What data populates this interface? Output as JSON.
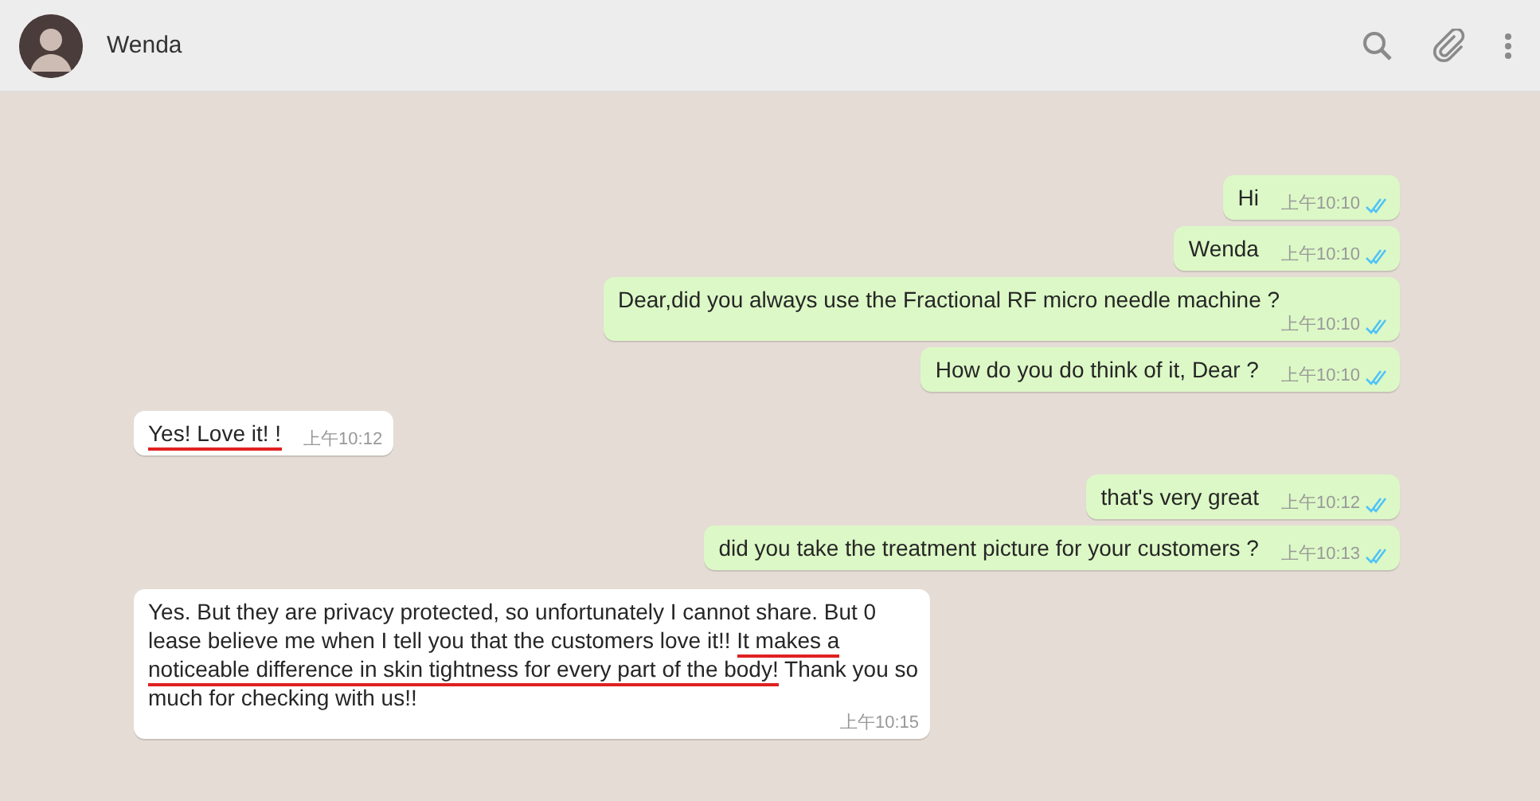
{
  "header": {
    "contact_name": "Wenda"
  },
  "messages": [
    {
      "kind": "outgoing",
      "segments": [
        {
          "text": "Hi",
          "underlined": false
        }
      ],
      "time": "上午10:10",
      "read": true
    },
    {
      "kind": "outgoing",
      "segments": [
        {
          "text": "Wenda",
          "underlined": false
        }
      ],
      "time": "上午10:10",
      "read": true
    },
    {
      "kind": "outgoing",
      "segments": [
        {
          "text": "Dear,did you always use the Fractional RF micro needle machine ?",
          "underlined": false
        }
      ],
      "time": "上午10:10",
      "read": true
    },
    {
      "kind": "outgoing",
      "segments": [
        {
          "text": "How do you do think of it, Dear ?",
          "underlined": false
        }
      ],
      "time": "上午10:10",
      "read": true
    },
    {
      "kind": "incoming",
      "segments": [
        {
          "text": "Yes!  Love it! !",
          "underlined": true
        }
      ],
      "time": "上午10:12"
    },
    {
      "kind": "outgoing",
      "segments": [
        {
          "text": "that's very great",
          "underlined": false
        }
      ],
      "time": "上午10:12",
      "read": true
    },
    {
      "kind": "outgoing",
      "segments": [
        {
          "text": "did you take the treatment picture for your customers ?",
          "underlined": false
        }
      ],
      "time": "上午10:13",
      "read": true
    },
    {
      "kind": "incoming",
      "segments": [
        {
          "text": "Yes. But they are privacy protected, so unfortunately I cannot share.   But 0 lease believe me when I tell you that the customers love it!!  ",
          "underlined": false
        },
        {
          "text": "It makes a noticeable difference in skin tightness for every part of the body!",
          "underlined": true
        },
        {
          "text": "  Thank you so much for checking with us!!",
          "underlined": false
        }
      ],
      "time": "上午10:15"
    }
  ]
}
